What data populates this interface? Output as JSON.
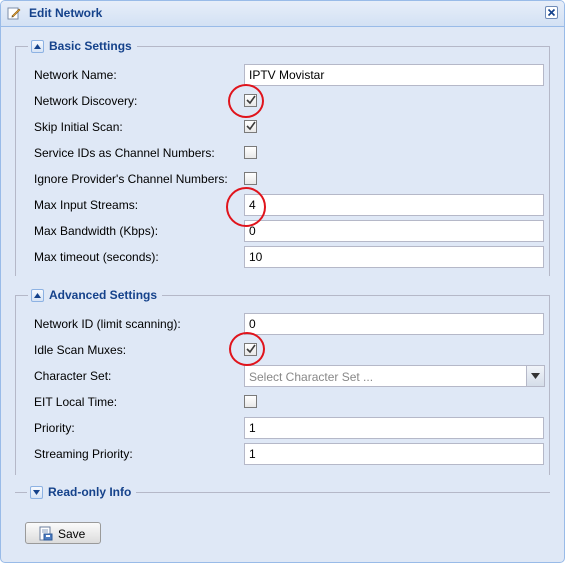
{
  "window": {
    "title": "Edit Network"
  },
  "basic": {
    "legend": "Basic Settings",
    "network_name": {
      "label": "Network Name:",
      "value": "IPTV Movistar"
    },
    "network_discovery": {
      "label": "Network Discovery:",
      "checked": true
    },
    "skip_initial_scan": {
      "label": "Skip Initial Scan:",
      "checked": true
    },
    "service_ids": {
      "label": "Service IDs as Channel Numbers:",
      "checked": false
    },
    "ignore_provider": {
      "label": "Ignore Provider's Channel Numbers:",
      "checked": false
    },
    "max_input_streams": {
      "label": "Max Input Streams:",
      "value": "4"
    },
    "max_bandwidth": {
      "label": "Max Bandwidth (Kbps):",
      "value": "0"
    },
    "max_timeout": {
      "label": "Max timeout (seconds):",
      "value": "10"
    }
  },
  "advanced": {
    "legend": "Advanced Settings",
    "network_id": {
      "label": "Network ID (limit scanning):",
      "value": "0"
    },
    "idle_scan_muxes": {
      "label": "Idle Scan Muxes:",
      "checked": true
    },
    "character_set": {
      "label": "Character Set:",
      "placeholder": "Select Character Set ..."
    },
    "eit_local_time": {
      "label": "EIT Local Time:",
      "checked": false
    },
    "priority": {
      "label": "Priority:",
      "value": "1"
    },
    "streaming_priority": {
      "label": "Streaming Priority:",
      "value": "1"
    }
  },
  "readonly": {
    "legend": "Read-only Info"
  },
  "buttons": {
    "save": "Save"
  },
  "colors": {
    "accent": "#15428b",
    "panel_bg": "#dfe8f6",
    "border": "#99bbe8",
    "annotation": "#e0141c"
  }
}
